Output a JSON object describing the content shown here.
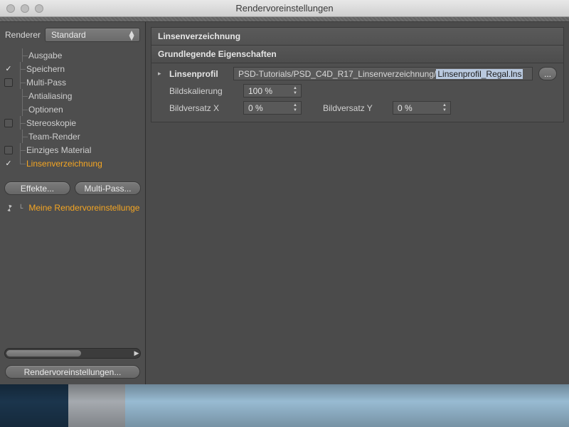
{
  "window": {
    "title": "Rendervoreinstellungen"
  },
  "sidebar": {
    "renderer_label": "Renderer",
    "renderer_value": "Standard",
    "items": [
      {
        "label": "Ausgabe",
        "check": "spacer"
      },
      {
        "label": "Speichern",
        "check": "checked"
      },
      {
        "label": "Multi-Pass",
        "check": "box"
      },
      {
        "label": "Antialiasing",
        "check": "spacer"
      },
      {
        "label": "Optionen",
        "check": "spacer"
      },
      {
        "label": "Stereoskopie",
        "check": "box"
      },
      {
        "label": "Team-Render",
        "check": "spacer"
      },
      {
        "label": "Einziges Material",
        "check": "box"
      },
      {
        "label": "Linsenverzeichnung",
        "check": "checked",
        "selected": true
      }
    ],
    "effects_button": "Effekte...",
    "multipass_button": "Multi-Pass...",
    "preset_label": "Meine Rendervoreinstellunge",
    "render_settings_button": "Rendervoreinstellungen..."
  },
  "main": {
    "section_title": "Linsenverzeichnung",
    "subsection_title": "Grundlegende Eigenschaften",
    "lensprofile": {
      "label": "Linsenprofil",
      "path_prefix": "PSD-Tutorials/PSD_C4D_R17_Linsenverzeichnung/",
      "path_selected": "Linsenprofil_Regal.lns",
      "browse": "..."
    },
    "scale": {
      "label": "Bildskalierung",
      "value": "100 %"
    },
    "offx": {
      "label": "Bildversatz X",
      "value": "0 %"
    },
    "offy": {
      "label": "Bildversatz Y",
      "value": "0 %"
    }
  }
}
